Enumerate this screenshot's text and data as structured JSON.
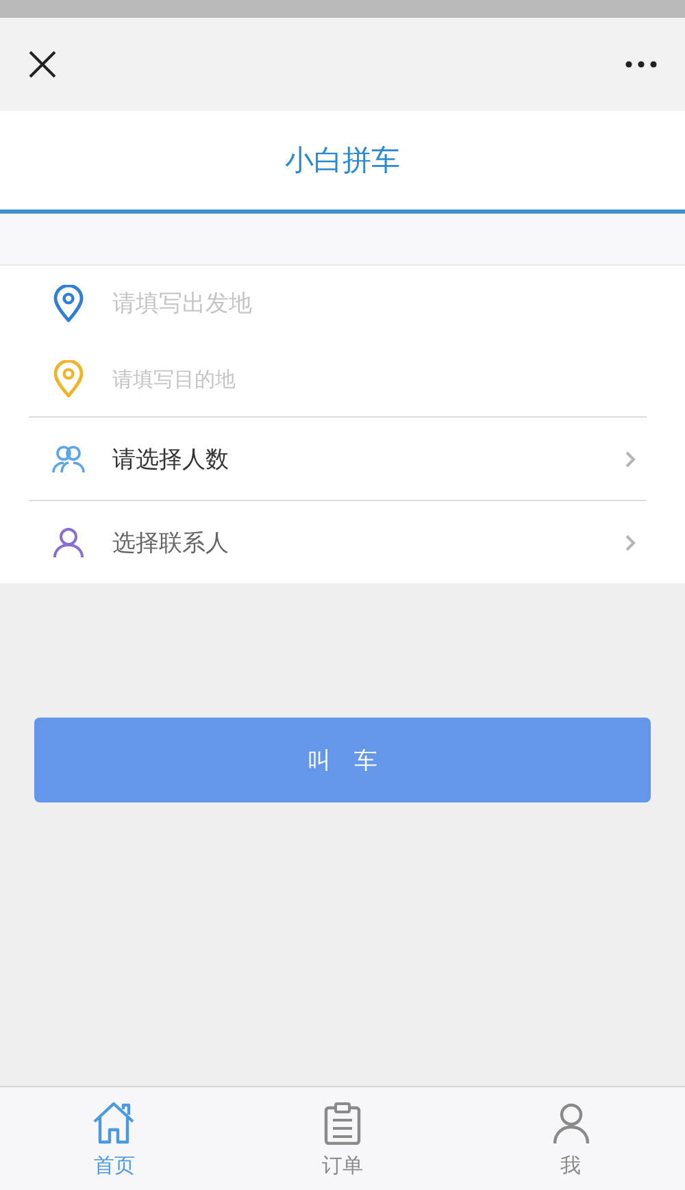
{
  "title": "小白拼车",
  "form": [
    {
      "kind": "input",
      "color": "#2f7fd8",
      "placeholder": "请填写出发地"
    },
    {
      "kind": "input",
      "color": "#f0b429",
      "placeholder": "请填写目的地"
    },
    {
      "kind": "select",
      "color": "#5aa6e8",
      "label": "请选择人数"
    },
    {
      "kind": "select",
      "color": "#8a6fd0",
      "label": "选择联系人"
    }
  ],
  "submit": "叫　车",
  "tabs": [
    {
      "label": "首页",
      "selected": true
    },
    {
      "label": "订单",
      "selected": false
    },
    {
      "label": "我",
      "selected": false
    }
  ]
}
